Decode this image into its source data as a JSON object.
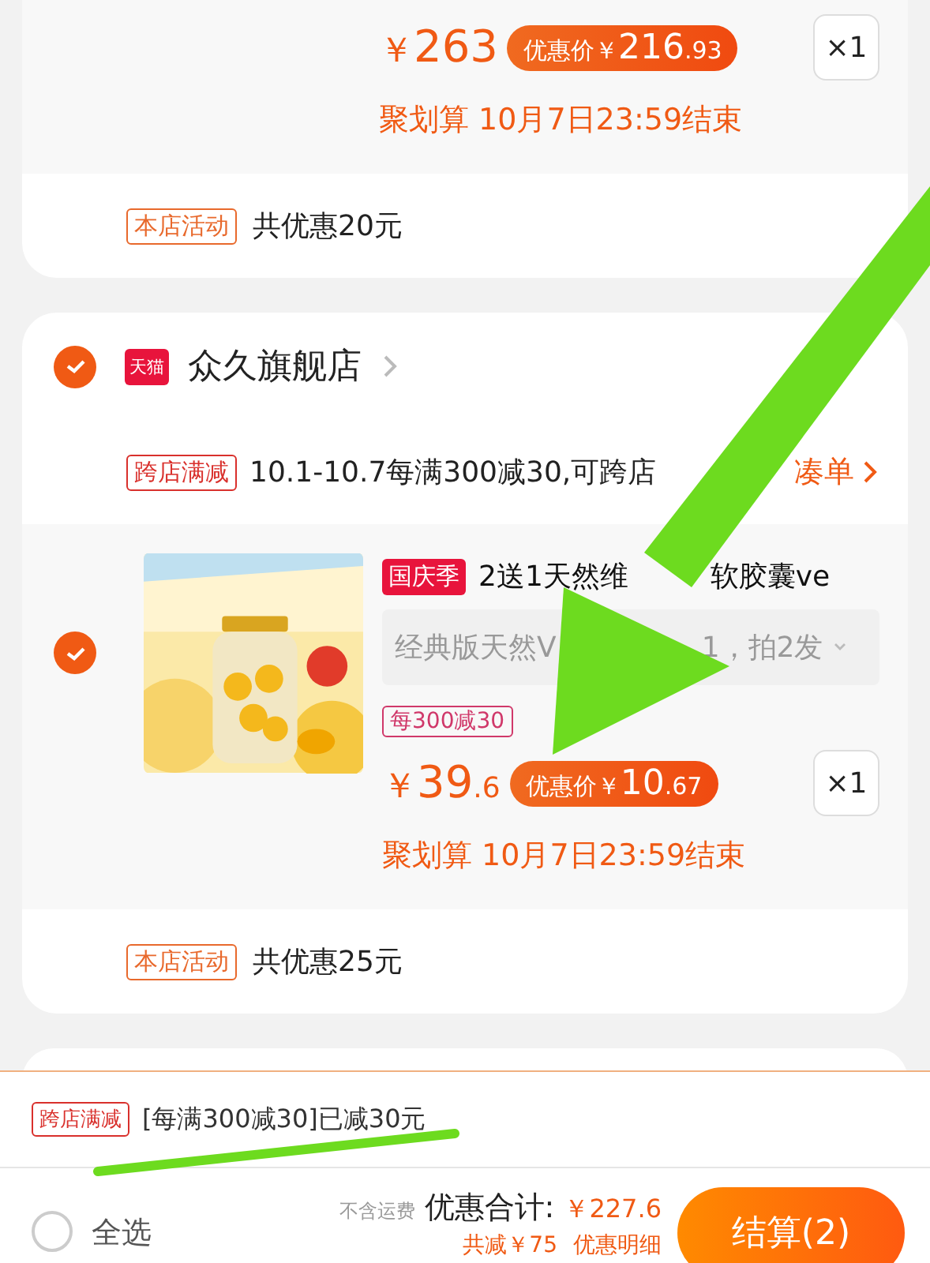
{
  "cards": [
    {
      "items": [
        {
          "currency": "￥",
          "price": "263",
          "deal_label": "优惠价",
          "deal_currency": "￥",
          "deal_price": "216",
          "deal_fraction": ".93",
          "quantity": "×1",
          "deadline": "聚划算 10月7日23:59结束"
        }
      ],
      "activity": {
        "tag": "本店活动",
        "text": "共优惠20元"
      }
    },
    {
      "store": {
        "checked": true,
        "badge": "天猫",
        "name": "众久旗舰店"
      },
      "promo": {
        "tag": "跨店满减",
        "text": "10.1-10.7每满300减30,可跨店",
        "link": "凑单"
      },
      "items": [
        {
          "checked": true,
          "kind": "picture",
          "tag": "国庆季",
          "title_parts": [
            "2送1天然维",
            "软胶囊ve"
          ],
          "sku_parts": [
            "经典版天然V",
            "1，拍2发"
          ],
          "promo_tag": "每300减30",
          "currency": "￥",
          "price": "39",
          "price_fraction": ".6",
          "deal_label": "优惠价",
          "deal_currency": "￥",
          "deal_price": "10",
          "deal_fraction": ".67",
          "quantity": "×1",
          "deadline": "聚划算 10月7日23:59结束"
        }
      ],
      "activity": {
        "tag": "本店活动",
        "text": "共优惠25元"
      }
    }
  ],
  "cross_promo": {
    "tag": "跨店满减",
    "text": "[每满300减30]已减30元"
  },
  "footer": {
    "select_all": {
      "label": "全选",
      "checked": false
    },
    "shipping_note": "不含运费",
    "total_label": "优惠合计:",
    "total": "￥227.6",
    "savings": "共减￥75",
    "details": "优惠明细",
    "checkout": "结算(2)"
  }
}
